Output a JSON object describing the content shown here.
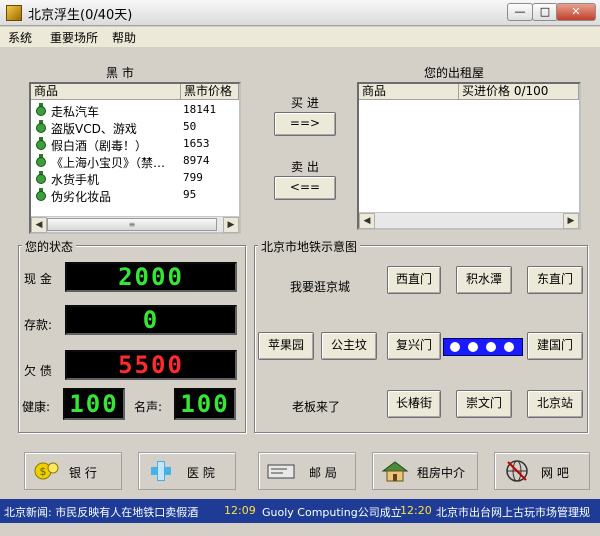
{
  "window": {
    "title": "北京浮生(0/40天)",
    "minimize_label": "—",
    "maximize_label": "□",
    "close_label": "✕"
  },
  "menu": [
    "系统",
    "重要场所",
    "帮助"
  ],
  "black_market": {
    "title": "黑 市",
    "columns": [
      "商品",
      "黑市价格"
    ],
    "rows": [
      {
        "name": "走私汽车",
        "price": "18141"
      },
      {
        "name": "盗版VCD、游戏",
        "price": "50"
      },
      {
        "name": "假白酒（剧毒！）",
        "price": "1653"
      },
      {
        "name": "《上海小宝贝》（禁…",
        "price": "8974"
      },
      {
        "name": "水货手机",
        "price": "799"
      },
      {
        "name": "伪劣化妆品",
        "price": "95"
      }
    ],
    "scroll_thumb": "≡"
  },
  "rental": {
    "title": "您的出租屋",
    "columns": [
      "商品",
      "买进价格 0/100"
    ]
  },
  "trade": {
    "buy_label": "买 进",
    "buy_button": "==>",
    "sell_label": "卖 出",
    "sell_button": "<=="
  },
  "status": {
    "title": "您的状态",
    "cash_label": "现 金",
    "cash": "2000",
    "deposit_label": "存款:",
    "deposit": "0",
    "debt_label": "欠 债",
    "debt": "5500",
    "health_label": "健康:",
    "health": "100",
    "fame_label": "名声:",
    "fame": "100"
  },
  "metro": {
    "title": "北京市地铁示意图",
    "prompt": "我要逛京城",
    "boss_label": "老板来了",
    "stations": [
      "西直门",
      "积水潭",
      "东直门",
      "苹果园",
      "公主坟",
      "复兴门",
      "建国门",
      "长椿街",
      "崇文门",
      "北京站"
    ]
  },
  "places": [
    {
      "label": "银 行",
      "icon": "bank-icon"
    },
    {
      "label": "医 院",
      "icon": "hospital-icon"
    },
    {
      "label": "邮 局",
      "icon": "post-office-icon"
    },
    {
      "label": "租房中介",
      "icon": "house-agency-icon"
    },
    {
      "label": "网 吧",
      "icon": "internet-cafe-icon"
    }
  ],
  "news": {
    "item1": "北京新闻: 市民反映有人在地铁口卖假酒",
    "time1": "12:09",
    "item2": "Guoly Computing公司成立",
    "time2": "12:20",
    "item3": "北京市出台网上古玩市场管理规"
  },
  "colors": {
    "lcd_green": "#35e635",
    "lcd_red": "#ff2a2a",
    "metro_line": "#1a1aff",
    "status_bar": "#1e3c96"
  }
}
